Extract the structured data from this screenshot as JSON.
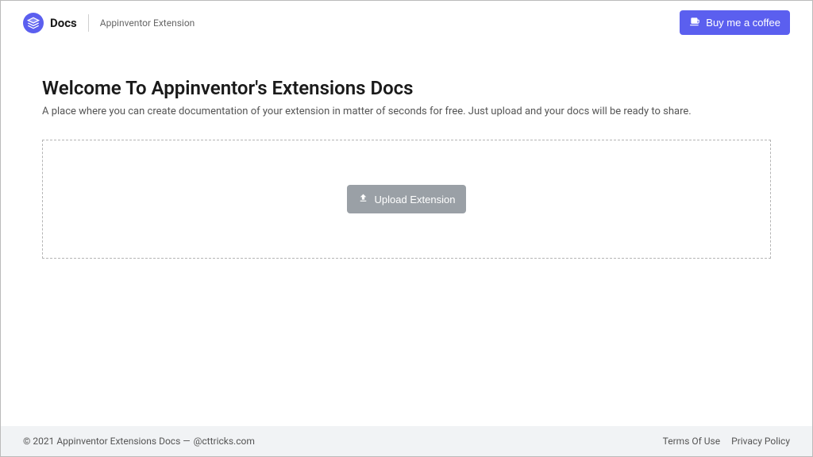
{
  "header": {
    "logo_title": "Docs",
    "subtitle": "Appinventor Extension",
    "coffee_label": "Buy me a coffee"
  },
  "main": {
    "title": "Welcome To Appinventor's Extensions Docs",
    "description": "A place where you can create documentation of your extension in matter of seconds for free. Just upload and your docs will be ready to share.",
    "upload_label": "Upload Extension"
  },
  "footer": {
    "copyright": "© 2021 Appinventor Extensions Docs —",
    "credit": "@cttricks.com",
    "links": {
      "terms": "Terms Of Use",
      "privacy": "Privacy Policy"
    }
  }
}
